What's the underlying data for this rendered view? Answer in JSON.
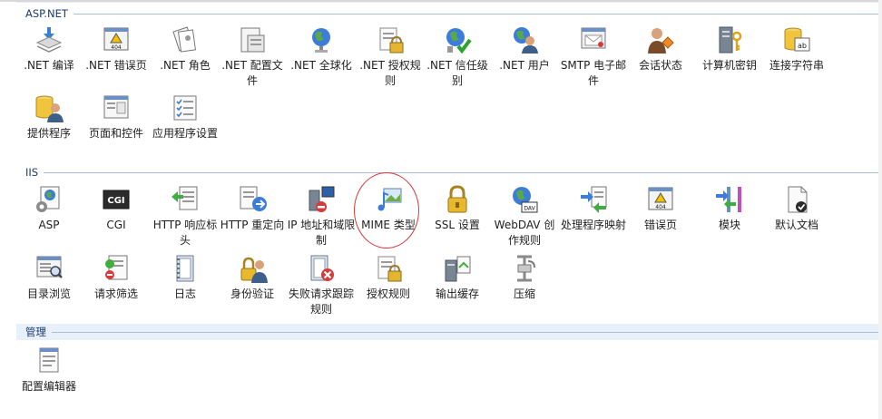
{
  "sections": {
    "aspnet": "ASP.NET",
    "iis": "IIS",
    "management": "管理"
  },
  "aspnet": [
    {
      "label": ".NET 编译",
      "icon": "compile-icon"
    },
    {
      "label": ".NET 错误页",
      "icon": "error-page-404-icon"
    },
    {
      "label": ".NET 角色",
      "icon": "roles-icon"
    },
    {
      "label": ".NET 配置文件",
      "icon": "profile-icon"
    },
    {
      "label": ".NET 全球化",
      "icon": "globe-icon"
    },
    {
      "label": ".NET 授权规则",
      "icon": "authorization-rules-icon"
    },
    {
      "label": ".NET 信任级别",
      "icon": "trust-level-icon"
    },
    {
      "label": ".NET 用户",
      "icon": "users-icon"
    },
    {
      "label": "SMTP 电子邮件",
      "icon": "smtp-email-icon"
    },
    {
      "label": "会话状态",
      "icon": "session-state-icon"
    },
    {
      "label": "计算机密钥",
      "icon": "machine-key-icon"
    },
    {
      "label": "连接字符串",
      "icon": "connection-string-icon"
    },
    {
      "label": "提供程序",
      "icon": "providers-icon"
    },
    {
      "label": "页面和控件",
      "icon": "pages-controls-icon"
    },
    {
      "label": "应用程序设置",
      "icon": "app-settings-icon"
    }
  ],
  "iis": [
    {
      "label": "ASP",
      "icon": "asp-icon"
    },
    {
      "label": "CGI",
      "icon": "cgi-icon"
    },
    {
      "label": "HTTP 响应标头",
      "icon": "http-headers-icon"
    },
    {
      "label": "HTTP 重定向",
      "icon": "http-redirect-icon"
    },
    {
      "label": "IP 地址和域限制",
      "icon": "ip-restrictions-icon"
    },
    {
      "label": "MIME 类型",
      "icon": "mime-types-icon"
    },
    {
      "label": "SSL 设置",
      "icon": "ssl-lock-icon"
    },
    {
      "label": "WebDAV 创作规则",
      "icon": "webdav-icon"
    },
    {
      "label": "处理程序映射",
      "icon": "handler-mappings-icon"
    },
    {
      "label": "错误页",
      "icon": "error-page-icon"
    },
    {
      "label": "模块",
      "icon": "modules-icon"
    },
    {
      "label": "默认文档",
      "icon": "default-document-icon"
    },
    {
      "label": "目录浏览",
      "icon": "directory-browsing-icon"
    },
    {
      "label": "请求筛选",
      "icon": "request-filtering-icon"
    },
    {
      "label": "日志",
      "icon": "logging-icon"
    },
    {
      "label": "身份验证",
      "icon": "authentication-icon"
    },
    {
      "label": "失败请求跟踪规则",
      "icon": "failed-request-tracing-icon"
    },
    {
      "label": "授权规则",
      "icon": "iis-authorization-icon"
    },
    {
      "label": "输出缓存",
      "icon": "output-caching-icon"
    },
    {
      "label": "压缩",
      "icon": "compression-icon"
    }
  ],
  "management": [
    {
      "label": "配置编辑器",
      "icon": "configuration-editor-icon"
    }
  ],
  "colors": {
    "section_text": "#1e3a6e",
    "section_rule": "#a9bedb",
    "highlight_circle": "#d23b3b"
  }
}
